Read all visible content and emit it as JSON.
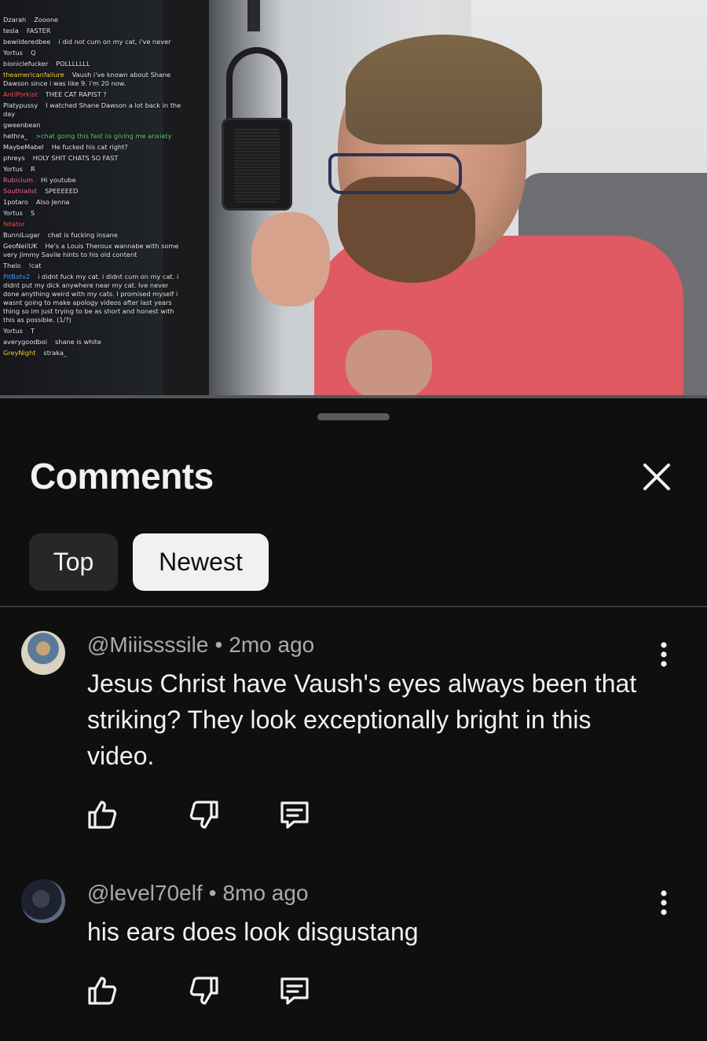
{
  "video": {
    "chat": [
      {
        "user": "Dzarah",
        "msg": "Zooone",
        "user_color": "",
        "msg_color": ""
      },
      {
        "user": "tesla",
        "msg": "FASTER",
        "user_color": "",
        "msg_color": ""
      },
      {
        "user": "bewilderedbee",
        "msg": "i did not cum on my cat, i've never",
        "user_color": "",
        "msg_color": ""
      },
      {
        "user": "Yortus",
        "msg": "Q",
        "user_color": "",
        "msg_color": ""
      },
      {
        "user": "bioniclefucker",
        "msg": "POLLLLLLL",
        "user_color": "",
        "msg_color": ""
      },
      {
        "user": "theamericanfailure",
        "msg": "Vaush i've known about Shane Dawson since i was like 9. i'm 20 now.",
        "user_color": "c-yellow",
        "msg_color": ""
      },
      {
        "user": "AntiPorkist",
        "msg": "THEE CAT RAPIST ?",
        "user_color": "c-red",
        "msg_color": ""
      },
      {
        "user": "Platypussy",
        "msg": "I watched Shane Dawson a lot back in the day",
        "user_color": "",
        "msg_color": ""
      },
      {
        "user": "gweenbean",
        "msg": "",
        "user_color": "",
        "msg_color": ""
      },
      {
        "user": "hethra_",
        "msg": ">chat going this fast iis giving me anxiety",
        "user_color": "",
        "msg_color": "c-green"
      },
      {
        "user": "MaybeMabel",
        "msg": "He fucked his cat right?",
        "user_color": "",
        "msg_color": ""
      },
      {
        "user": "phreys",
        "msg": "HOLY SHIT CHATS SO FAST",
        "user_color": "",
        "msg_color": ""
      },
      {
        "user": "Yortus",
        "msg": "R",
        "user_color": "",
        "msg_color": ""
      },
      {
        "user": "Rubicium",
        "msg": "Hi youtube",
        "user_color": "c-pink",
        "msg_color": ""
      },
      {
        "user": "Southialist",
        "msg": "SPEEEEED",
        "user_color": "c-pink",
        "msg_color": ""
      },
      {
        "user": "1potaro",
        "msg": "Also Jenna",
        "user_color": "",
        "msg_color": ""
      },
      {
        "user": "Yortus",
        "msg": "S",
        "user_color": "",
        "msg_color": ""
      },
      {
        "user": "fetator",
        "msg": "",
        "user_color": "c-red",
        "msg_color": ""
      },
      {
        "user": "BunniLugar",
        "msg": "chat is fucking insane",
        "user_color": "",
        "msg_color": ""
      },
      {
        "user": "GeoNeilUK",
        "msg": "He's a Louis Theroux wannabe with some very Jimmy Savile hints to his old content",
        "user_color": "",
        "msg_color": ""
      },
      {
        "user": "Thelo",
        "msg": "!cat",
        "user_color": "",
        "msg_color": ""
      },
      {
        "user": "PitBotv2",
        "msg": "i didnt fuck my cat. i didnt cum on my cat. i didnt put my dick anywhere near my cat. Ive never done anything weird with my cats. I promised myself i wasnt going to make apology videos after last years thing so im just trying to be as short and honest with this as possible. (1/?)",
        "user_color": "c-blue",
        "msg_color": ""
      },
      {
        "user": "Yortus",
        "msg": "T",
        "user_color": "",
        "msg_color": ""
      },
      {
        "user": "averygoodboi",
        "msg": "shane is white",
        "user_color": "",
        "msg_color": ""
      },
      {
        "user": "GreyNight",
        "msg": "straka_",
        "user_color": "c-yellow",
        "msg_color": ""
      }
    ]
  },
  "comments_panel": {
    "title": "Comments",
    "close_icon": "close-icon",
    "chips": {
      "top": "Top",
      "newest": "Newest",
      "selected": "Newest"
    },
    "comments": [
      {
        "author": "@Miiissssile",
        "separator": "•",
        "time": "2mo ago",
        "text": "Jesus Christ have Vaush's eyes always been that striking? They look exceptionally bright in this video."
      },
      {
        "author": "@level70elf",
        "separator": "•",
        "time": "8mo ago",
        "text": "his ears does look disgustang"
      }
    ],
    "icons": {
      "like": "thumbs-up-icon",
      "dislike": "thumbs-down-icon",
      "reply": "reply-icon",
      "more": "more-vert-icon"
    },
    "colors": {
      "background": "#0f0f0f",
      "chip_inactive": "#272727",
      "chip_active": "#f1f1f1",
      "meta_text": "#aaaaaa"
    }
  }
}
